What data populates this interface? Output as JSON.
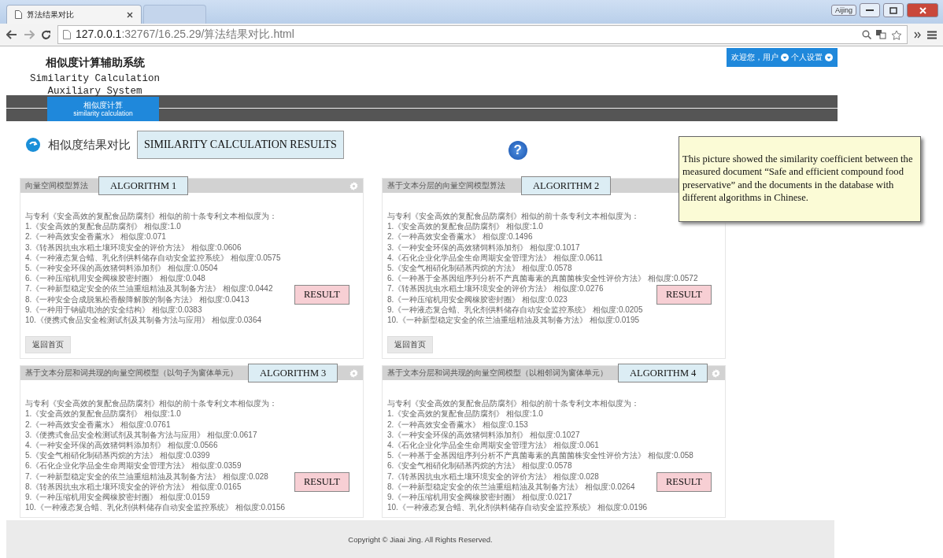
{
  "browser": {
    "tabs": [
      {
        "title": "算法结果对比",
        "selected": true
      },
      {
        "selected": false
      }
    ],
    "profile": "Aijing",
    "url": {
      "host": "127.0.0.1",
      "path": ":32767/16.25.29/算法结果对比.html"
    }
  },
  "header": {
    "logo_cn": "相似度计算辅助系统",
    "logo_en": [
      "Similarity Calculation",
      "Auxiliary System"
    ],
    "welcome": "欢迎您，用户",
    "settings": "个人设置"
  },
  "nav": [
    {
      "label_cn": "相似度计算",
      "label_en": "similarity calculation",
      "selected": true
    }
  ],
  "page_title": {
    "title": "相似度结果对比",
    "annotation": "SIMILARITY CALCULATION RESULTS",
    "help": "?"
  },
  "note": "This picture showed the similarity coefficient between the measured document “Safe and efficient compound food preservative” and the documents in the database with different algorithms in Chinese.",
  "panels": [
    {
      "title": "向量空间模型算法",
      "algorithm": "ALGORITHM 1",
      "settings_icon": true,
      "intro": "与专利《安全高效的复配食品防腐剂》相似的前十条专利文本相似度为：",
      "items": [
        "1.《安全高效的复配食品防腐剂》 相似度:1.0",
        "2.《一种高效安全香薰水》 相似度:0.071",
        "3.《转基因抗虫水稻土壤环境安全的评价方法》 相似度:0.0606",
        "4.《一种液态复合蜡、乳化剂供料储存自动安全监控系统》 相似度:0.0575",
        "5.《一种安全环保的高效猪饲料添加剂》 相似度:0.0504",
        "6.《一种压缩机用安全阀橡胶密封圈》 相似度:0.048",
        "7.《一种新型稳定安全的依兰油重组精油及其制备方法》 相似度:0.0442",
        "8.《一种安全合成脱氢松香酸降解胺的制备方法》 相似度:0.0413",
        "9.《一种用于钠硫电池的安全结构》 相似度:0.0383",
        "10.《便携式食品安全检测试剂及其制备方法与应用》 相似度:0.0364"
      ],
      "result": "RESULT",
      "back": "返回首页"
    },
    {
      "title": "基于文本分层的向量空间模型算法",
      "algorithm": "ALGORITHM 2",
      "settings_icon": false,
      "intro": "与专利《安全高效的复配食品防腐剂》相似的前十条专利文本相似度为：",
      "items": [
        "1.《安全高效的复配食品防腐剂》 相似度:1.0",
        "2.《一种高效安全香薰水》 相似度:0.1496",
        "3.《一种安全环保的高效猪饲料添加剂》 相似度:0.1017",
        "4.《石化企业化学品全生命周期安全管理方法》 相似度:0.0611",
        "5.《安全气相硝化制硝基丙烷的方法》 相似度:0.0578",
        "6.《一种基于全基因组序列分析不产真菌毒素的真菌菌株安全性评价方法》 相似度:0.0572",
        "7.《转基因抗虫水稻土壤环境安全的评价方法》 相似度:0.0276",
        "8.《一种压缩机用安全阀橡胶密封圈》 相似度:0.023",
        "9.《一种液态复合蜡、乳化剂供料储存自动安全监控系统》 相似度:0.0205",
        "10.《一种新型稳定安全的依兰油重组精油及其制备方法》 相似度:0.0195"
      ],
      "result": "RESULT",
      "back": "返回首页"
    },
    {
      "title": "基于文本分层和词共现的向量空间模型（以句子为窗体单元）",
      "algorithm": "ALGORITHM 3",
      "settings_icon": true,
      "intro": "与专利《安全高效的复配食品防腐剂》相似的前十条专利文本相似度为：",
      "items": [
        "1.《安全高效的复配食品防腐剂》 相似度:1.0",
        "2.《一种高效安全香薰水》 相似度:0.0761",
        "3.《便携式食品安全检测试剂及其制备方法与应用》 相似度:0.0617",
        "4.《一种安全环保的高效猪饲料添加剂》 相似度:0.0566",
        "5.《安全气相硝化制硝基丙烷的方法》 相似度:0.0399",
        "6.《石化企业化学品全生命周期安全管理方法》 相似度:0.0359",
        "7.《一种新型稳定安全的依兰油重组精油及其制备方法》 相似度:0.028",
        "8.《转基因抗虫水稻土壤环境安全的评价方法》 相似度:0.0165",
        "9.《一种压缩机用安全阀橡胶密封圈》 相似度:0.0159",
        "10.《一种液态复合蜡、乳化剂供料储存自动安全监控系统》 相似度:0.0156"
      ],
      "result": "RESULT"
    },
    {
      "title": "基于文本分层和词共现的向量空间模型（以相邻词为窗体单元）",
      "algorithm": "ALGORITHM 4",
      "settings_icon": true,
      "intro": "与专利《安全高效的复配食品防腐剂》相似的前十条专利文本相似度为：",
      "items": [
        "1.《安全高效的复配食品防腐剂》 相似度:1.0",
        "2.《一种高效安全香薰水》 相似度:0.153",
        "3.《一种安全环保的高效猪饲料添加剂》 相似度:0.1027",
        "4.《石化企业化学品全生命周期安全管理方法》 相似度:0.061",
        "5.《一种基于全基因组序列分析不产真菌毒素的真菌菌株安全性评价方法》 相似度:0.058",
        "6.《安全气相硝化制硝基丙烷的方法》 相似度:0.0578",
        "7.《转基因抗虫水稻土壤环境安全的评价方法》 相似度:0.028",
        "8.《一种新型稳定安全的依兰油重组精油及其制备方法》 相似度:0.0264",
        "9.《一种压缩机用安全阀橡胶密封圈》 相似度:0.0217",
        "10.《一种液态复合蜡、乳化剂供料储存自动安全监控系统》 相似度:0.0196"
      ],
      "result": "RESULT"
    }
  ],
  "footer": "Copyright © Jiaai Jing. All Rights Reserved."
}
